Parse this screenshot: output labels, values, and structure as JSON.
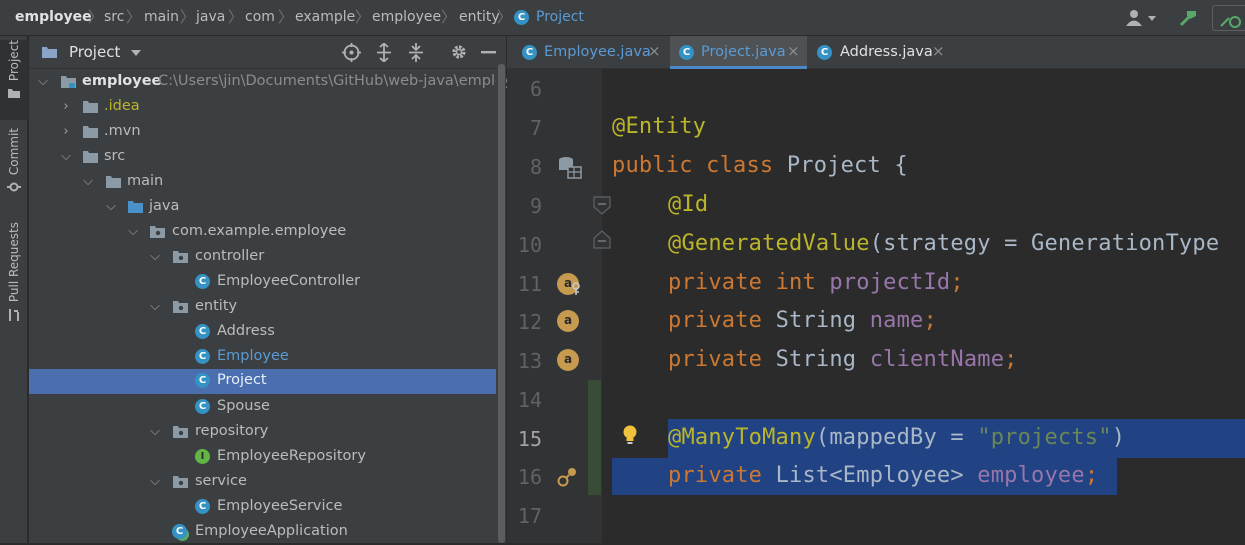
{
  "navbar": {
    "crumbs": [
      "employee",
      "src",
      "main",
      "java",
      "com",
      "example",
      "employee",
      "entity",
      "Project"
    ],
    "icons": [
      "person-icon",
      "build-hammer-icon",
      "run-config-icon"
    ]
  },
  "tool_stripe": {
    "tabs": [
      "Project",
      "Commit",
      "Pull Requests"
    ]
  },
  "project_panel": {
    "title": "Project",
    "icons": [
      "locate-icon",
      "expand-all-icon",
      "collapse-all-icon",
      "gear-icon",
      "minimize-icon"
    ],
    "tree": [
      {
        "label": "employee",
        "path": "C:\\Users\\jin\\Documents\\GitHub\\web-java\\employee",
        "icon": "module-folder-icon",
        "state": "open"
      },
      {
        "label": ".idea",
        "icon": "folder-icon",
        "state": "closed"
      },
      {
        "label": ".mvn",
        "icon": "folder-icon",
        "state": "closed"
      },
      {
        "label": "src",
        "icon": "folder-icon",
        "state": "open"
      },
      {
        "label": "main",
        "icon": "folder-icon",
        "state": "open"
      },
      {
        "label": "java",
        "icon": "source-folder-icon",
        "state": "open"
      },
      {
        "label": "com.example.employee",
        "icon": "package-icon",
        "state": "open"
      },
      {
        "label": "controller",
        "icon": "package-icon",
        "state": "open"
      },
      {
        "label": "EmployeeController",
        "icon": "class-icon",
        "badge": "C"
      },
      {
        "label": "entity",
        "icon": "package-icon",
        "state": "open"
      },
      {
        "label": "Address",
        "icon": "class-icon",
        "badge": "C"
      },
      {
        "label": "Employee",
        "icon": "class-icon",
        "badge": "C"
      },
      {
        "label": "Project",
        "icon": "class-icon",
        "badge": "C",
        "selected": true
      },
      {
        "label": "Spouse",
        "icon": "class-icon",
        "badge": "C"
      },
      {
        "label": "repository",
        "icon": "package-icon",
        "state": "open"
      },
      {
        "label": "EmployeeRepository",
        "icon": "interface-icon",
        "badge": "I"
      },
      {
        "label": "service",
        "icon": "package-icon",
        "state": "open"
      },
      {
        "label": "EmployeeService",
        "icon": "class-icon",
        "badge": "C"
      },
      {
        "label": "EmployeeApplication",
        "icon": "spring-app-icon",
        "badge": "C"
      }
    ]
  },
  "editor": {
    "tabs": [
      {
        "label": "Employee.java",
        "badge": "C",
        "close": "×"
      },
      {
        "label": "Project.java",
        "badge": "C",
        "close": "×",
        "active": true
      },
      {
        "label": "Address.java",
        "badge": "C",
        "close": "×"
      }
    ],
    "line_numbers": [
      "6",
      "7",
      "8",
      "9",
      "10",
      "11",
      "12",
      "13",
      "14",
      "15",
      "16",
      "17"
    ],
    "current_line": "15",
    "gutter_badge": "a",
    "code": {
      "l7": {
        "ann": "@Entity"
      },
      "l8": {
        "kw1": "public",
        "kw2": "class",
        "name": "Project",
        "brace": "{"
      },
      "l9": {
        "ann": "@Id"
      },
      "l10": {
        "ann": "@GeneratedValue",
        "rest": "(strategy = GenerationType"
      },
      "l11": {
        "kw": "private",
        "type": "int",
        "field": "projectId",
        "semi": ";"
      },
      "l12": {
        "kw": "private",
        "type": "String",
        "field": "name",
        "semi": ";"
      },
      "l13": {
        "kw": "private",
        "type": "String",
        "field": "clientName",
        "semi": ";"
      },
      "l15": {
        "ann": "@ManyToMany",
        "open": "(mappedBy = ",
        "str": "\"projects\"",
        "close": ")"
      },
      "l16": {
        "kw": "private",
        "type": "List<Employee>",
        "field": "employee",
        "semi": ";"
      }
    }
  },
  "colors": {
    "background": "#2b2b2b",
    "panel": "#3c3f41",
    "selection": "#4b6eaf",
    "code_selection": "#214283",
    "keyword": "#cc7832",
    "annotation": "#bbb529",
    "field": "#9876aa",
    "string": "#6a8759",
    "class_icon": "#3592c4",
    "interface_icon": "#62b543"
  }
}
